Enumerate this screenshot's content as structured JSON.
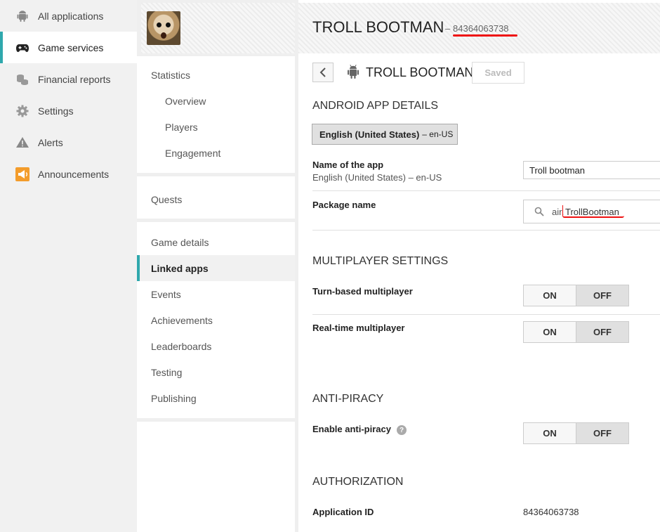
{
  "leftnav": {
    "items": [
      {
        "label": "All applications",
        "icon": "android-icon"
      },
      {
        "label": "Game services",
        "icon": "gamepad-icon"
      },
      {
        "label": "Financial reports",
        "icon": "coins-icon"
      },
      {
        "label": "Settings",
        "icon": "gear-icon"
      },
      {
        "label": "Alerts",
        "icon": "warning-icon"
      },
      {
        "label": "Announcements",
        "icon": "megaphone-icon"
      }
    ],
    "active_index": 1,
    "accent": "#2fa8ad",
    "announcement_color": "#f39c2b"
  },
  "game_menu": {
    "stats_heading": "Statistics",
    "stats_items": [
      "Overview",
      "Players",
      "Engagement"
    ],
    "quests": "Quests",
    "items": [
      "Game details",
      "Linked apps",
      "Events",
      "Achievements",
      "Leaderboards",
      "Testing",
      "Publishing"
    ],
    "active": "Linked apps"
  },
  "header": {
    "title": "TROLL BOOTMAN",
    "dash": "–",
    "id": "84364063738"
  },
  "linked_app": {
    "back_icon": "chevron-left-icon",
    "platform_icon": "android-icon",
    "title": "TROLL BOOTMAN",
    "saved_label": "Saved"
  },
  "android_details": {
    "heading": "ANDROID APP DETAILS",
    "language_label": "English (United States)",
    "language_code": "– en-US",
    "name_label": "Name of the app",
    "name_sub": "English (United States) – en-US",
    "name_value": "Troll bootman",
    "package_label": "Package name",
    "package_prefix": "air.",
    "package_value": "TrollBootman"
  },
  "multiplayer": {
    "heading": "MULTIPLAYER SETTINGS",
    "turn_based_label": "Turn-based multiplayer",
    "realtime_label": "Real-time multiplayer",
    "on_label": "ON",
    "off_label": "OFF",
    "turn_based_state": "OFF",
    "realtime_state": "OFF"
  },
  "anti_piracy": {
    "heading": "ANTI-PIRACY",
    "label": "Enable anti-piracy",
    "help": "?",
    "on_label": "ON",
    "off_label": "OFF",
    "state": "OFF"
  },
  "authorization": {
    "heading": "AUTHORIZATION",
    "appid_label": "Application ID",
    "appid_value": "84364063738"
  },
  "colors": {
    "highlight_red": "#e11111"
  }
}
